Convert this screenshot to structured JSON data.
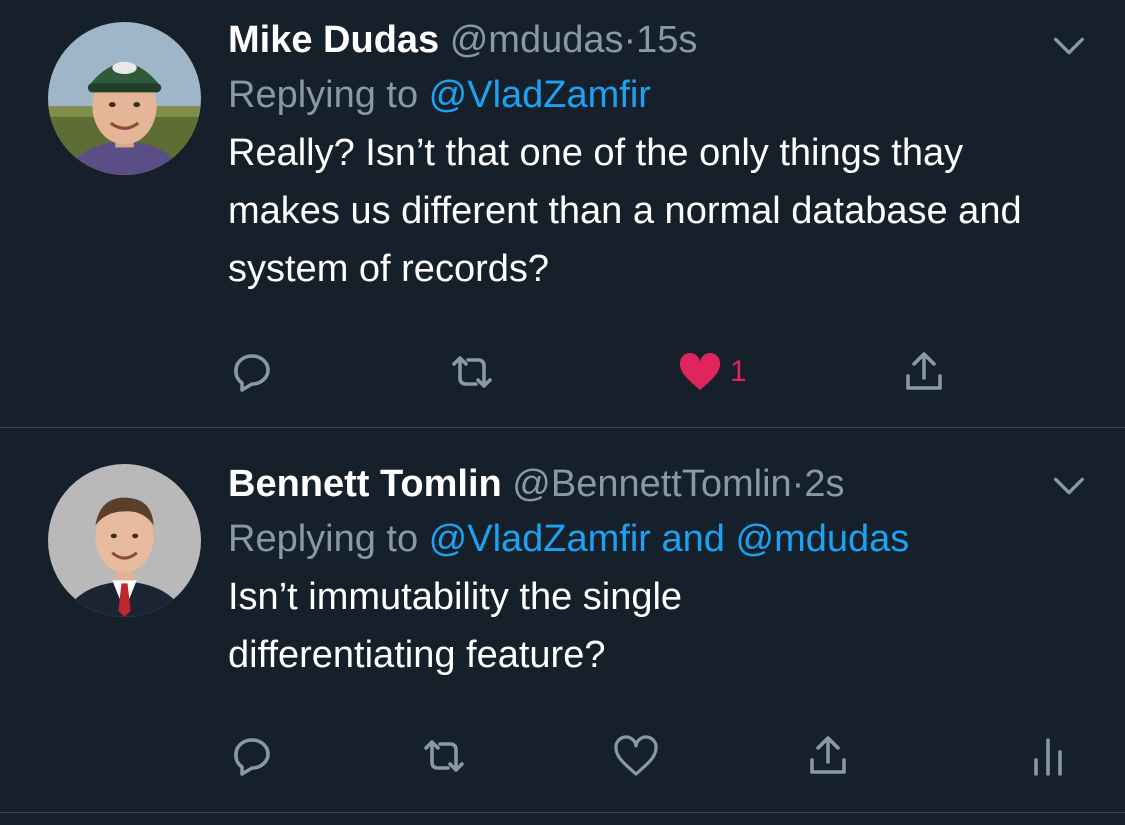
{
  "tweets": [
    {
      "name": "Mike Dudas",
      "handle": "@mdudas",
      "separator": "·",
      "time": "15s",
      "replying_prefix": "Replying to ",
      "replying_to_1": "@VladZamfir",
      "body": "Really? Isn’t that one of the only things thay makes us different than a normal database and system of records?",
      "liked": true,
      "like_count": "1",
      "avatar_icon": "avatar-man-green-cap"
    },
    {
      "name": "Bennett Tomlin",
      "handle": "@BennettTomlin",
      "separator": "·",
      "time": "2s",
      "replying_prefix": "Replying to ",
      "replying_to_1": "@VladZamfir",
      "replying_joiner": " and ",
      "replying_to_2": "@mdudas",
      "body": "Isn’t immutability the single differentiating feature?",
      "liked": false,
      "avatar_icon": "avatar-man-suit-red-tie"
    }
  ],
  "colors": {
    "background": "#15202b",
    "text": "#ffffff",
    "muted": "#8899a6",
    "link": "#1da1f2",
    "like": "#e0245e",
    "divider": "#38444d"
  },
  "icons": [
    "reply-icon",
    "retweet-icon",
    "like-icon",
    "share-icon",
    "analytics-icon",
    "chevron-down-icon"
  ]
}
